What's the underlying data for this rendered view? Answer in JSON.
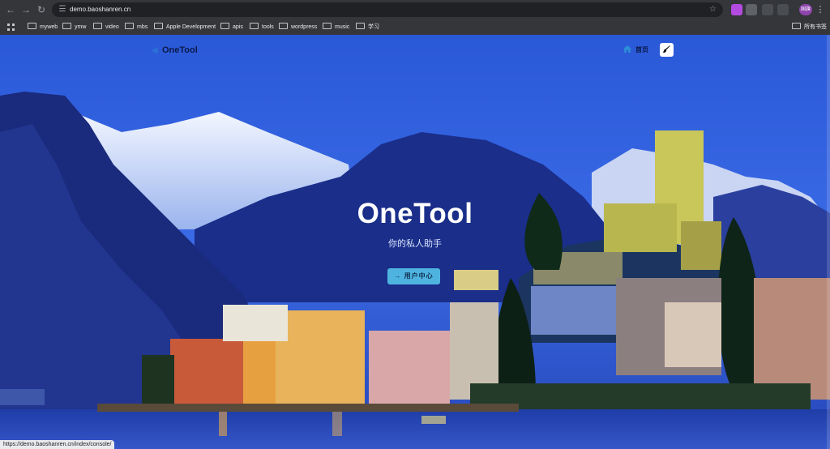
{
  "browser": {
    "url": "demo.baoshanren.cn",
    "profile_label": "国旗",
    "bookmarks": [
      "myweb",
      "ymw",
      "video",
      "mbs",
      "Apple Development",
      "apis",
      "tools",
      "wordpress",
      "music",
      "学习"
    ],
    "all_bookmarks_label": "所有书签",
    "status_url": "https://demo.baoshanren.cn/index/console/"
  },
  "site": {
    "logo_text": "OneTool",
    "nav_home": "首页",
    "hero_title": "OneTool",
    "hero_subtitle": "你的私人助手",
    "cta_label": "用户中心",
    "cta_icon": "arrow-right-icon",
    "theme_icon": "brush-icon",
    "accent_color": "#4fb3e0"
  }
}
